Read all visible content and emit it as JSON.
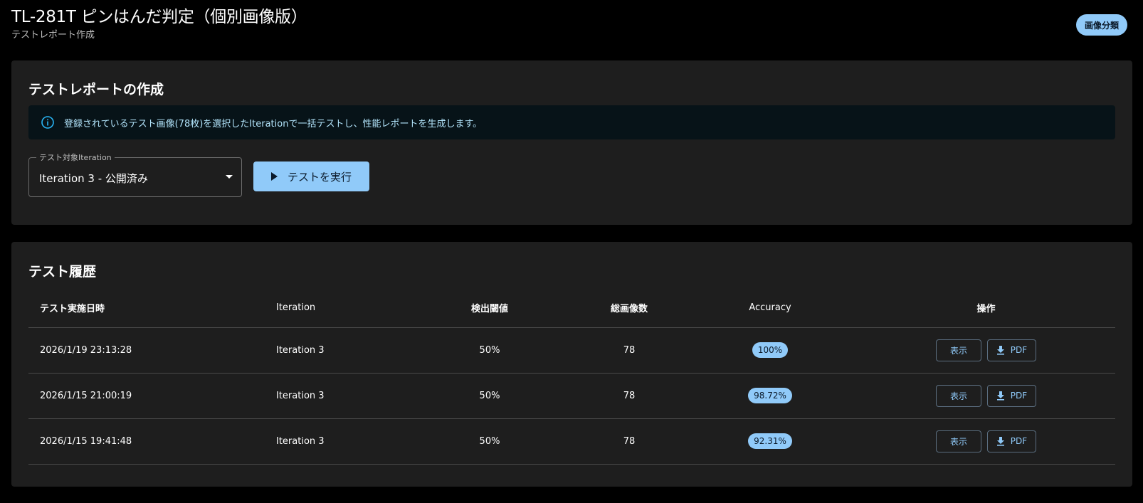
{
  "header": {
    "title": "TL-281T ピンはんだ判定（個別画像版）",
    "subtitle": "テストレポート作成",
    "classify_button": "画像分類"
  },
  "create": {
    "title": "テストレポートの作成",
    "alert_icon": "info-icon",
    "alert_text": "登録されているテスト画像(78枚)を選択したIterationで一括テストし、性能レポートを生成します。",
    "select_label": "テスト対象Iteration",
    "select_value": "Iteration 3 - 公開済み",
    "run_button": "テストを実行",
    "run_icon": "play-icon"
  },
  "history": {
    "title": "テスト履歴",
    "columns": [
      "テスト実施日時",
      "Iteration",
      "検出閾値",
      "総画像数",
      "Accuracy",
      "操作"
    ],
    "rows": [
      {
        "date": "2026/1/19 23:13:28",
        "iteration": "Iteration 3",
        "threshold": "50%",
        "count": "78",
        "accuracy": "100%",
        "view": "表示",
        "pdf": "PDF"
      },
      {
        "date": "2026/1/15 21:00:19",
        "iteration": "Iteration 3",
        "threshold": "50%",
        "count": "78",
        "accuracy": "98.72%",
        "view": "表示",
        "pdf": "PDF"
      },
      {
        "date": "2026/1/15 19:41:48",
        "iteration": "Iteration 3",
        "threshold": "50%",
        "count": "78",
        "accuracy": "92.31%",
        "view": "表示",
        "pdf": "PDF"
      }
    ]
  },
  "colors": {
    "accent": "#90caf9",
    "card_bg": "#1e1e1e",
    "page_bg": "#000000",
    "alert_bg": "#071318"
  }
}
